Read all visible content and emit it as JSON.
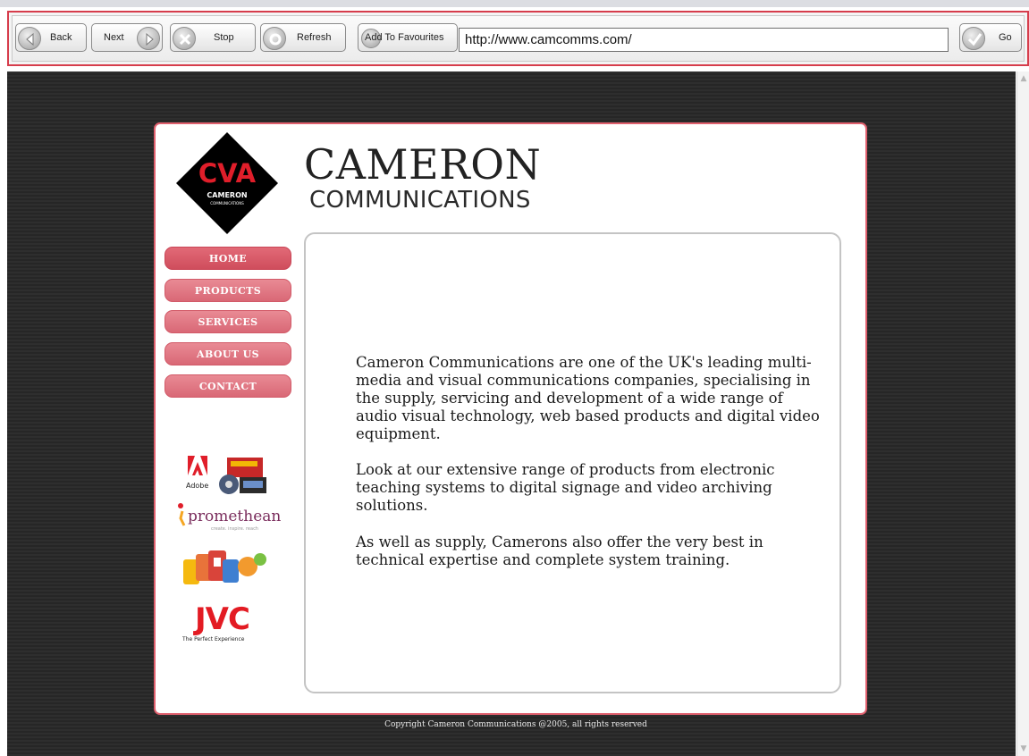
{
  "browser": {
    "back_label": "Back",
    "next_label": "Next",
    "stop_label": "Stop",
    "refresh_label": "Refresh",
    "favourites_label": "Add To Favourites",
    "url": "http://www.camcomms.com/",
    "go_label": "Go"
  },
  "site": {
    "logo_text": "CVA",
    "logo_caption": "CAMERON",
    "logo_subcaption": "COMMUNICATIONS",
    "brand_title": "CAMERON",
    "brand_subtitle": "COMMUNICATIONS",
    "nav": [
      {
        "label": "HOME",
        "active": true
      },
      {
        "label": "PRODUCTS",
        "active": false
      },
      {
        "label": "SERVICES",
        "active": false
      },
      {
        "label": "ABOUT US",
        "active": false
      },
      {
        "label": "CONTACT",
        "active": false
      }
    ],
    "paragraphs": [
      "Cameron Communications are one of the UK's leading multi-media and visual communications companies, specialising in the supply, servicing and development of a wide range of audio visual technology, web based products and digital video equipment.",
      "Look at our extensive range of products from electronic teaching systems to digital signage and video archiving solutions.",
      "As well as supply, Camerons also offer the very best in technical expertise and complete system training."
    ],
    "partners": {
      "adobe": "Adobe",
      "promethean": "promethean",
      "promethean_tag": "create. inspire. reach",
      "jvc": "JVC",
      "jvc_tag": "The Perfect Experience"
    },
    "footer": "Copyright Cameron Communications @2005, all rights reserved"
  },
  "colors": {
    "accent": "#d63d4c",
    "nav_pink": "#e07a85",
    "viewport_bg": "#2b2b2b",
    "logo_red": "#e01e2a"
  }
}
